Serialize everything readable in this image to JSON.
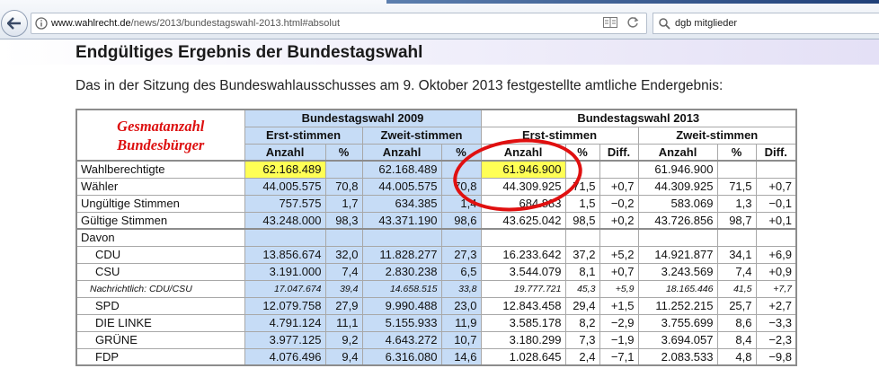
{
  "browser": {
    "url_host": "www.wahlrecht.de",
    "url_path": "/news/2013/bundestagswahl-2013.html#absolut",
    "search_text": "dgb mitglieder"
  },
  "page": {
    "title": "Endgültiges Ergebnis der Bundestagswahl",
    "intro": "Das in der Sitzung des Bundeswahlausschusses am 9. Oktober 2013 festgestellte amtliche Endergebnis:"
  },
  "table": {
    "brand_line1": "Gesmatanzahl",
    "brand_line2": "Bundesbürger",
    "group_2009": "Bundestagswahl 2009",
    "group_2013": "Bundestagswahl 2013",
    "erst_label": "Erst-stimmen",
    "zweit_label": "Zweit-stimmen",
    "col_anzahl": "Anzahl",
    "col_pct": "%",
    "col_diff": "Diff.",
    "rows": [
      {
        "label": "Wahlberechtigte",
        "v": [
          "62.168.489",
          "",
          "62.168.489",
          "",
          "61.946.900",
          "",
          "",
          "61.946.900",
          "",
          ""
        ]
      },
      {
        "label": "Wähler",
        "v": [
          "44.005.575",
          "70,8",
          "44.005.575",
          "70,8",
          "44.309.925",
          "71,5",
          "+0,7",
          "44.309.925",
          "71,5",
          "+0,7"
        ]
      },
      {
        "label": "Ungültige Stimmen",
        "v": [
          "757.575",
          "1,7",
          "634.385",
          "1,4",
          "684.883",
          "1,5",
          "−0,2",
          "583.069",
          "1,3",
          "−0,1"
        ]
      },
      {
        "label": "Gültige Stimmen",
        "v": [
          "43.248.000",
          "98,3",
          "43.371.190",
          "98,6",
          "43.625.042",
          "98,5",
          "+0,2",
          "43.726.856",
          "98,7",
          "+0,1"
        ]
      },
      {
        "label": "Davon",
        "v": [
          "",
          "",
          "",
          "",
          "",
          "",
          "",
          "",
          "",
          ""
        ]
      },
      {
        "label": "CDU",
        "v": [
          "13.856.674",
          "32,0",
          "11.828.277",
          "27,3",
          "16.233.642",
          "37,2",
          "+5,2",
          "14.921.877",
          "34,1",
          "+6,9"
        ]
      },
      {
        "label": "CSU",
        "v": [
          "3.191.000",
          "7,4",
          "2.830.238",
          "6,5",
          "3.544.079",
          "8,1",
          "+0,7",
          "3.243.569",
          "7,4",
          "+0,9"
        ]
      },
      {
        "label": "Nachrichtlich: CDU/CSU",
        "v": [
          "17.047.674",
          "39,4",
          "14.658.515",
          "33,8",
          "19.777.721",
          "45,3",
          "+5,9",
          "18.165.446",
          "41,5",
          "+7,7"
        ]
      },
      {
        "label": "SPD",
        "v": [
          "12.079.758",
          "27,9",
          "9.990.488",
          "23,0",
          "12.843.458",
          "29,4",
          "+1,5",
          "11.252.215",
          "25,7",
          "+2,7"
        ]
      },
      {
        "label": "DIE LINKE",
        "v": [
          "4.791.124",
          "11,1",
          "5.155.933",
          "11,9",
          "3.585.178",
          "8,2",
          "−2,9",
          "3.755.699",
          "8,6",
          "−3,3"
        ]
      },
      {
        "label": "GRÜNE",
        "v": [
          "3.977.125",
          "9,2",
          "4.643.272",
          "10,7",
          "3.180.299",
          "7,3",
          "−1,9",
          "3.694.057",
          "8,4",
          "−2,3"
        ]
      },
      {
        "label": "FDP",
        "v": [
          "4.076.496",
          "9,4",
          "6.316.080",
          "14,6",
          "1.028.645",
          "2,4",
          "−7,1",
          "2.083.533",
          "4,8",
          "−9,8"
        ]
      }
    ]
  }
}
